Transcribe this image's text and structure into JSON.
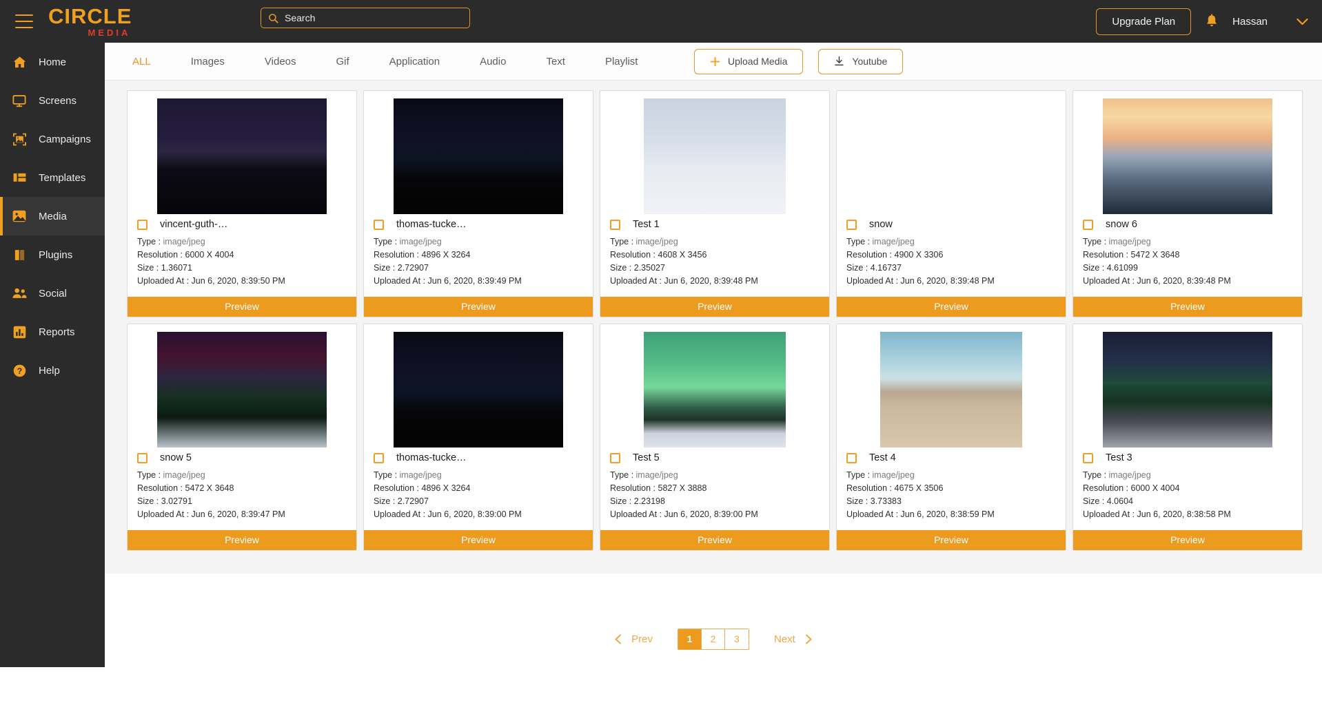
{
  "header": {
    "logo_main": "CIRCLE",
    "logo_sub": "MEDIA",
    "search_placeholder": "Search",
    "search_value": "",
    "upgrade_label": "Upgrade Plan",
    "username": "Hassan"
  },
  "sidebar": {
    "items": [
      {
        "label": "Home",
        "icon": "home-icon",
        "active": false
      },
      {
        "label": "Screens",
        "icon": "monitor-icon",
        "active": false
      },
      {
        "label": "Campaigns",
        "icon": "campaign-icon",
        "active": false
      },
      {
        "label": "Templates",
        "icon": "layout-icon",
        "active": false
      },
      {
        "label": "Media",
        "icon": "image-icon",
        "active": true
      },
      {
        "label": "Plugins",
        "icon": "plugin-icon",
        "active": false
      },
      {
        "label": "Social",
        "icon": "people-icon",
        "active": false
      },
      {
        "label": "Reports",
        "icon": "chart-icon",
        "active": false
      },
      {
        "label": "Help",
        "icon": "question-icon",
        "active": false
      }
    ]
  },
  "tabs": [
    {
      "label": "ALL",
      "active": true
    },
    {
      "label": "Images",
      "active": false
    },
    {
      "label": "Videos",
      "active": false
    },
    {
      "label": "Gif",
      "active": false
    },
    {
      "label": "Application",
      "active": false
    },
    {
      "label": "Audio",
      "active": false
    },
    {
      "label": "Text",
      "active": false
    },
    {
      "label": "Playlist",
      "active": false
    }
  ],
  "toolbar": {
    "upload_label": "Upload Media",
    "youtube_label": "Youtube"
  },
  "labels": {
    "type": "Type :",
    "resolution": "Resolution :",
    "size": "Size :",
    "uploaded_at": "Uploaded At :",
    "preview": "Preview"
  },
  "cards": [
    {
      "title": "vincent-guth-…",
      "type": "image/jpeg",
      "resolution": "6000 X 4004",
      "size": "1.36071",
      "uploaded_at": "Jun 6, 2020, 8:39:50 PM",
      "thumb": "aurora-mountain-lake"
    },
    {
      "title": "thomas-tucke…",
      "type": "image/jpeg",
      "resolution": "4896 X 3264",
      "size": "2.72907",
      "uploaded_at": "Jun 6, 2020, 8:39:49 PM",
      "thumb": "aurora-plane-wreck"
    },
    {
      "title": "Test 1",
      "type": "image/jpeg",
      "resolution": "4608 X 3456",
      "size": "2.35027",
      "uploaded_at": "Jun 6, 2020, 8:39:48 PM",
      "thumb": "snow-lantern"
    },
    {
      "title": "snow",
      "type": "image/jpeg",
      "resolution": "4900 X 3306",
      "size": "4.16737",
      "uploaded_at": "Jun 6, 2020, 8:39:48 PM",
      "thumb": "golden-lake-sunset"
    },
    {
      "title": "snow 6",
      "type": "image/jpeg",
      "resolution": "5472 X 3648",
      "size": "4.61099",
      "uploaded_at": "Jun 6, 2020, 8:39:48 PM",
      "thumb": "snow-forest-sunrise"
    },
    {
      "title": "snow 5",
      "type": "image/jpeg",
      "resolution": "5472 X 3648",
      "size": "3.02791",
      "uploaded_at": "Jun 6, 2020, 8:39:47 PM",
      "thumb": "aurora-red-forest"
    },
    {
      "title": "thomas-tucke…",
      "type": "image/jpeg",
      "resolution": "4896 X 3264",
      "size": "2.72907",
      "uploaded_at": "Jun 6, 2020, 8:39:00 PM",
      "thumb": "aurora-plane-wreck"
    },
    {
      "title": "Test 5",
      "type": "image/jpeg",
      "resolution": "5827 X 3888",
      "size": "2.23198",
      "uploaded_at": "Jun 6, 2020, 8:39:00 PM",
      "thumb": "aurora-white-car"
    },
    {
      "title": "Test 4",
      "type": "image/jpeg",
      "resolution": "4675 X 3506",
      "size": "3.73383",
      "uploaded_at": "Jun 6, 2020, 8:38:59 PM",
      "thumb": "pier-bridge-sea"
    },
    {
      "title": "Test 3",
      "type": "image/jpeg",
      "resolution": "6000 X 4004",
      "size": "4.0604",
      "uploaded_at": "Jun 6, 2020, 8:38:58 PM",
      "thumb": "aurora-green-swirl"
    }
  ],
  "pagination": {
    "prev_label": "Prev",
    "next_label": "Next",
    "pages": [
      "1",
      "2",
      "3"
    ],
    "current": "1"
  },
  "colors": {
    "accent": "#f0a020",
    "preview": "#ed9b1f",
    "header_bg": "#2b2b2b",
    "logo_sub": "#e03b2c"
  }
}
